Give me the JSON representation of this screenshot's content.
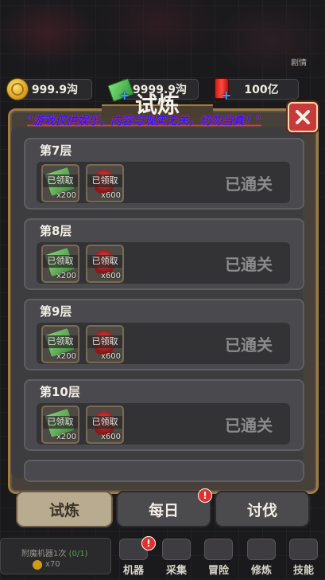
{
  "resources": [
    {
      "icon": "gold-coin-icon",
      "value": "999.9沟"
    },
    {
      "icon": "cash-bundle-icon",
      "value": "9999.9沟"
    },
    {
      "icon": "red-can-icon",
      "value": "100亿"
    }
  ],
  "side_label": "剧情",
  "panel": {
    "title": "试炼",
    "disclaimer": "\"游戏仅供娱乐，内容与现实无关，切勿当真！\"",
    "floors": [
      {
        "name": "第7层",
        "rewards": [
          {
            "type": "cash",
            "status": "已领取",
            "qty": "x200"
          },
          {
            "type": "red-bag",
            "status": "已领取",
            "qty": "x600"
          }
        ],
        "status": "已通关"
      },
      {
        "name": "第8层",
        "rewards": [
          {
            "type": "cash",
            "status": "已领取",
            "qty": "x200"
          },
          {
            "type": "red-bag",
            "status": "已领取",
            "qty": "x600"
          }
        ],
        "status": "已通关"
      },
      {
        "name": "第9层",
        "rewards": [
          {
            "type": "cash",
            "status": "已领取",
            "qty": "x200"
          },
          {
            "type": "red-bag",
            "status": "已领取",
            "qty": "x600"
          }
        ],
        "status": "已通关"
      },
      {
        "name": "第10层",
        "rewards": [
          {
            "type": "cash",
            "status": "已领取",
            "qty": "x200"
          },
          {
            "type": "red-bag",
            "status": "已领取",
            "qty": "x600"
          }
        ],
        "status": "已通关"
      }
    ]
  },
  "tabs": [
    {
      "label": "试炼",
      "active": true
    },
    {
      "label": "每日",
      "active": false,
      "badge": "!"
    },
    {
      "label": "讨伐",
      "active": false
    }
  ],
  "bottom": {
    "info_text": "附魔机器1次",
    "info_progress": "(0/1)",
    "info_reward": "x70",
    "nav": [
      {
        "label": "机器",
        "badge": "!"
      },
      {
        "label": "采集",
        "badge": ""
      },
      {
        "label": "冒险",
        "badge": ""
      },
      {
        "label": "修炼",
        "badge": ""
      },
      {
        "label": "技能",
        "badge": ""
      }
    ]
  },
  "colors": {
    "frame": "#a17c42",
    "disclaimer_text": "#2a1aff",
    "disclaimer_underline": "#ff2b2b",
    "close_button": "#c83a3a",
    "tab_active": "#b9ab90",
    "status_text": "#8b8b8e"
  }
}
